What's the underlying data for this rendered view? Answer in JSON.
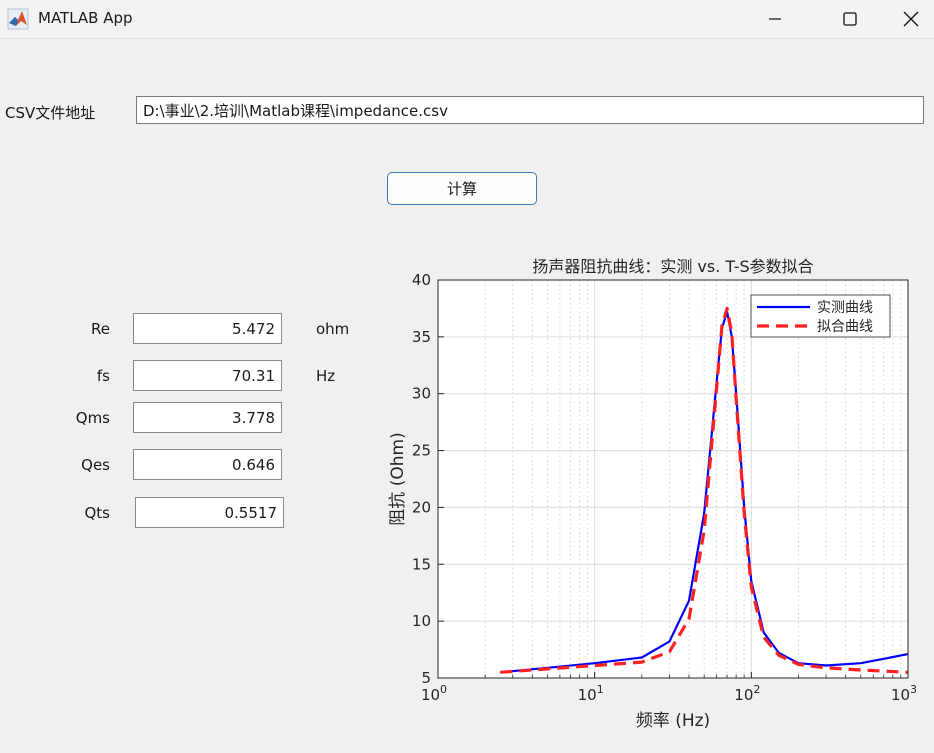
{
  "window": {
    "title": "MATLAB App",
    "app_icon": "matlab-logo-icon",
    "controls": [
      "minimize-icon",
      "maximize-icon",
      "close-icon"
    ]
  },
  "file": {
    "label": "CSV文件地址",
    "value": "D:\\事业\\2.培训\\Matlab课程\\impedance.csv"
  },
  "compute_button": {
    "label": "计算",
    "border_color": "#3f77b7"
  },
  "params": [
    {
      "label": "Re",
      "value": "5.472",
      "unit": "ohm"
    },
    {
      "label": "fs",
      "value": "70.31",
      "unit": "Hz"
    },
    {
      "label": "Qms",
      "value": "3.778",
      "unit": ""
    },
    {
      "label": "Qes",
      "value": "0.646",
      "unit": ""
    },
    {
      "label": "Qts",
      "value": "0.5517",
      "unit": ""
    }
  ],
  "chart_data": {
    "type": "line",
    "title": "扬声器阻抗曲线：实测 vs. T-S参数拟合",
    "xlabel": "频率 (Hz)",
    "ylabel": "阻抗 (Ohm)",
    "xscale": "log",
    "xlim": [
      1,
      1000
    ],
    "ylim": [
      5,
      40
    ],
    "xticks": [
      {
        "base": "10",
        "exp": "0"
      },
      {
        "base": "10",
        "exp": "1"
      },
      {
        "base": "10",
        "exp": "2"
      },
      {
        "base": "10",
        "exp": "3"
      }
    ],
    "yticks": [
      5,
      10,
      15,
      20,
      25,
      30,
      35,
      40
    ],
    "grid": true,
    "legend_position": "top-right",
    "series": [
      {
        "name": "实测曲线",
        "color": "#0000ff",
        "style": "solid",
        "x": [
          2.5,
          5,
          10,
          20,
          30,
          40,
          50,
          60,
          65,
          70,
          75,
          80,
          90,
          100,
          120,
          150,
          200,
          300,
          500,
          1000
        ],
        "y": [
          5.5,
          5.9,
          6.3,
          6.8,
          8.2,
          11.8,
          19.5,
          31.0,
          35.8,
          37.2,
          35.0,
          30.0,
          20.0,
          13.5,
          9.0,
          7.2,
          6.3,
          6.1,
          6.3,
          7.1
        ]
      },
      {
        "name": "拟合曲线",
        "color": "#ff2020",
        "style": "dashed",
        "x": [
          2.5,
          5,
          10,
          20,
          30,
          40,
          50,
          60,
          65,
          70,
          75,
          80,
          90,
          100,
          120,
          150,
          200,
          300,
          500,
          1000
        ],
        "y": [
          5.5,
          5.8,
          6.1,
          6.4,
          7.3,
          10.2,
          18.0,
          30.5,
          36.0,
          37.5,
          35.3,
          29.5,
          19.5,
          13.0,
          8.6,
          7.0,
          6.2,
          5.9,
          5.7,
          5.5
        ]
      }
    ]
  }
}
